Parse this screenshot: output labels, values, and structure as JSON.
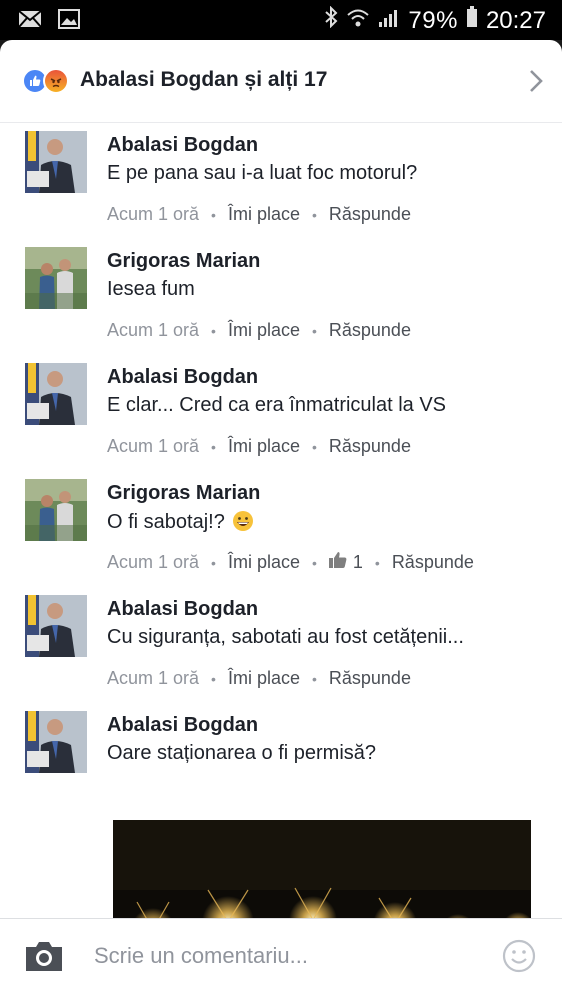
{
  "status_bar": {
    "battery": "79%",
    "time": "20:27",
    "icons": [
      "mail-icon",
      "gallery-icon",
      "bluetooth-icon",
      "wifi-icon",
      "signal-icon",
      "battery-icon"
    ]
  },
  "header": {
    "reactors": "Abalasi Bogdan și alți 17",
    "reaction_icons": [
      "like-reaction-icon",
      "angry-reaction-icon"
    ]
  },
  "comments": [
    {
      "author": "Abalasi Bogdan",
      "text": "E pe pana sau i-a luat foc motorul?",
      "time": "Acum 1 oră",
      "like": "Îmi place",
      "reply": "Răspunde"
    },
    {
      "author": "Grigoras Marian",
      "text": "Iesea fum",
      "time": "Acum 1 oră",
      "like": "Îmi place",
      "reply": "Răspunde"
    },
    {
      "author": "Abalasi Bogdan",
      "text": "E clar... Cred ca era înmatriculat la VS",
      "time": "Acum 1 oră",
      "like": "Îmi place",
      "reply": "Răspunde"
    },
    {
      "author": "Grigoras Marian",
      "text": "O fi sabotaj!?",
      "time": "Acum 1 oră",
      "like": "Îmi place",
      "like_count": "1",
      "reply": "Răspunde"
    },
    {
      "author": "Abalasi Bogdan",
      "text": "Cu siguranța, sabotati au fost cetățenii...",
      "time": "Acum 1 oră",
      "like": "Îmi place",
      "reply": "Răspunde"
    },
    {
      "author": "Abalasi Bogdan",
      "text": "Oare staționarea o fi permisă?"
    }
  ],
  "composer": {
    "placeholder": "Scrie un comentariu..."
  }
}
